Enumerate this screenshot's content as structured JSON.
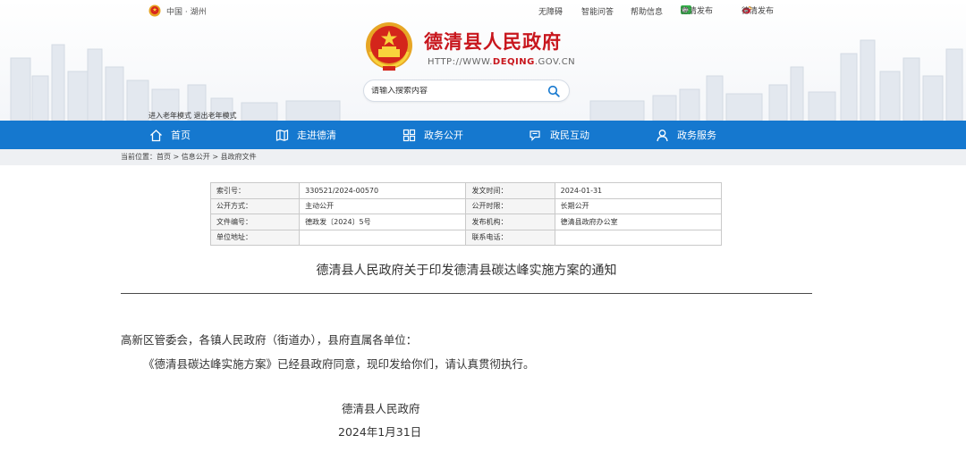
{
  "top": {
    "location": "中国 · 湖州",
    "links": [
      "无障碍",
      "智能问答",
      "帮助信息",
      "德清发布",
      "德清发布"
    ]
  },
  "site": {
    "title": "德清县人民政府",
    "url_prefix": "HTTP://WWW.",
    "url_domain": "DEQING",
    "url_suffix": ".GOV.CN"
  },
  "search": {
    "placeholder": "请输入搜索内容"
  },
  "elder_mode": "进入老年模式 退出老年模式",
  "nav": [
    "首页",
    "走进德清",
    "政务公开",
    "政民互动",
    "政务服务"
  ],
  "breadcrumb": {
    "prefix": "当前位置：",
    "items": [
      "首页",
      "信息公开",
      "县政府文件"
    ],
    "sep": " > "
  },
  "meta": [
    {
      "k1": "索引号：",
      "v1": "330521/2024-00570",
      "k2": "发文时间：",
      "v2": "2024-01-31"
    },
    {
      "k1": "公开方式：",
      "v1": "主动公开",
      "k2": "公开时限：",
      "v2": "长期公开"
    },
    {
      "k1": "文件编号：",
      "v1": "德政发〔2024〕5号",
      "k2": "发布机构：",
      "v2": "德清县政府办公室"
    },
    {
      "k1": "单位地址：",
      "v1": "",
      "k2": "联系电话：",
      "v2": ""
    }
  ],
  "doc": {
    "title": "德清县人民政府关于印发德清县碳达峰实施方案的通知",
    "salutation": "高新区管委会，各镇人民政府（街道办），县府直属各单位：",
    "body": "《德清县碳达峰实施方案》已经县政府同意，现印发给你们，请认真贯彻执行。",
    "signature": "德清县人民政府",
    "date": "2024年1月31日"
  },
  "colors": {
    "nav_bg": "#1578cf",
    "brand_red": "#c8161d"
  }
}
